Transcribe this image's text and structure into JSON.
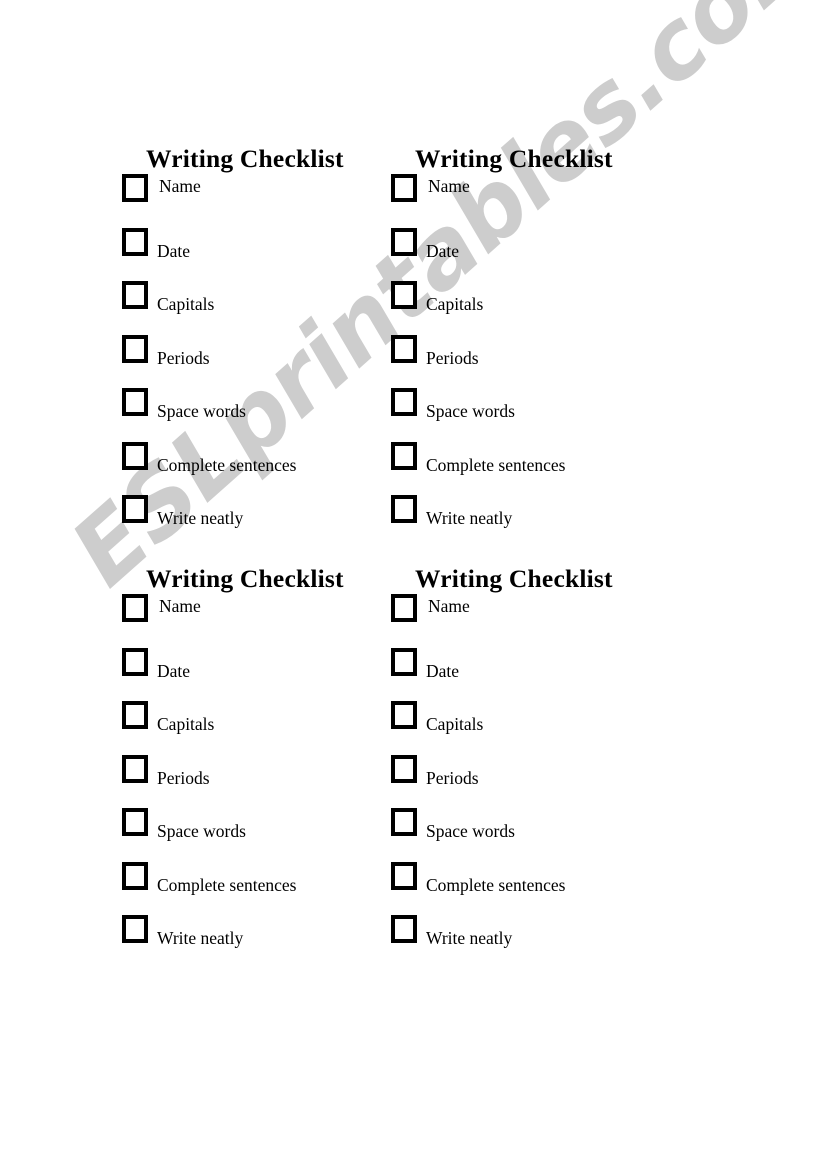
{
  "page": {
    "background_color": "#ffffff",
    "text_color": "#000000"
  },
  "watermark": {
    "text": "ESLprintables.com",
    "color": "#cdcdcd",
    "rotation_deg": -41.5
  },
  "checklist": {
    "title": "Writing Checklist",
    "items": [
      "Name",
      "Date",
      "Capitals",
      "Periods",
      "Space words",
      "Complete sentences",
      "Write neatly"
    ]
  },
  "panels": [
    {
      "id": "panel-top-left",
      "title": "Writing Checklist",
      "items": [
        "Name",
        "Date",
        "Capitals",
        "Periods",
        "Space words",
        "Complete sentences",
        "Write neatly"
      ]
    },
    {
      "id": "panel-top-right",
      "title": "Writing Checklist",
      "items": [
        "Name",
        "Date",
        "Capitals",
        "Periods",
        "Space words",
        "Complete sentences",
        "Write neatly"
      ]
    },
    {
      "id": "panel-bottom-left",
      "title": "Writing Checklist",
      "items": [
        "Name",
        "Date",
        "Capitals",
        "Periods",
        "Space words",
        "Complete sentences",
        "Write neatly"
      ]
    },
    {
      "id": "panel-bottom-right",
      "title": "Writing Checklist",
      "items": [
        "Name",
        "Date",
        "Capitals",
        "Periods",
        "Space words",
        "Complete sentences",
        "Write neatly"
      ]
    }
  ]
}
